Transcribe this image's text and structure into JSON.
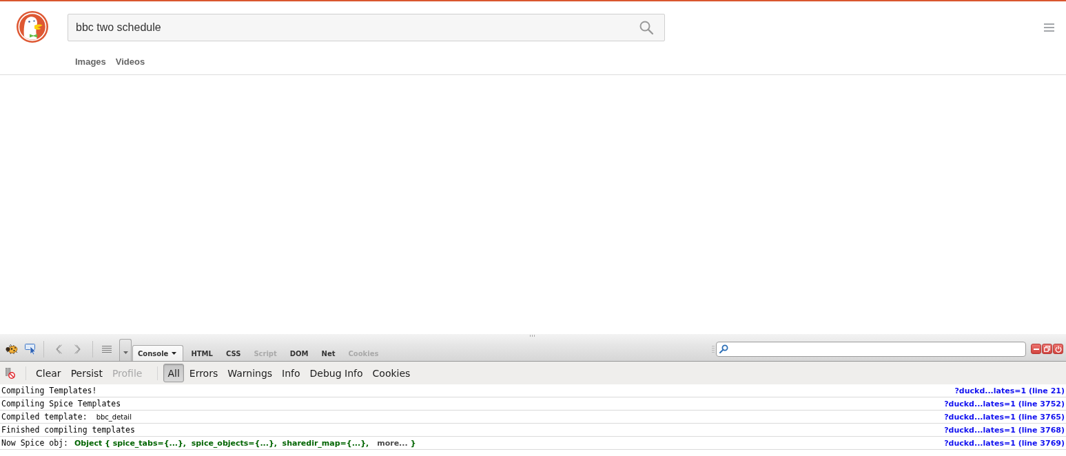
{
  "search": {
    "value": "bbc two schedule"
  },
  "nav": [
    {
      "label": "Images"
    },
    {
      "label": "Videos"
    }
  ],
  "devtools": {
    "panel_tabs": [
      {
        "label": "Console",
        "selected": true,
        "disabled": false
      },
      {
        "label": "HTML",
        "selected": false,
        "disabled": false
      },
      {
        "label": "CSS",
        "selected": false,
        "disabled": false
      },
      {
        "label": "Script",
        "selected": false,
        "disabled": true
      },
      {
        "label": "DOM",
        "selected": false,
        "disabled": false
      },
      {
        "label": "Net",
        "selected": false,
        "disabled": false
      },
      {
        "label": "Cookies",
        "selected": false,
        "disabled": true
      }
    ],
    "console_buttons": [
      {
        "label": "Clear",
        "disabled": false
      },
      {
        "label": "Persist",
        "disabled": false
      },
      {
        "label": "Profile",
        "disabled": true
      }
    ],
    "filters": [
      {
        "label": "All",
        "selected": true
      },
      {
        "label": "Errors",
        "selected": false
      },
      {
        "label": "Warnings",
        "selected": false
      },
      {
        "label": "Info",
        "selected": false
      },
      {
        "label": "Debug Info",
        "selected": false
      },
      {
        "label": "Cookies",
        "selected": false
      }
    ],
    "log": [
      {
        "kind": "text",
        "message": "Compiling Templates!",
        "source": "?duckd...lates=1 (line 21)"
      },
      {
        "kind": "text",
        "message": "Compiling Spice Templates",
        "source": "?duckd...lates=1 (line 3752)"
      },
      {
        "kind": "string",
        "message": "Compiled template:",
        "argument": "bbc_detail",
        "source": "?duckd...lates=1 (line 3765)"
      },
      {
        "kind": "text",
        "message": "Finished compiling templates",
        "source": "?duckd...lates=1 (line 3768)"
      },
      {
        "kind": "object",
        "message": "Now Spice obj:",
        "object": {
          "preview": "Object { spice_tabs={...},  spice_objects={...},  sharedir_map={...},",
          "more": "more...",
          "close": "}"
        },
        "source": "?duckd...lates=1 (line 3769)"
      }
    ]
  }
}
